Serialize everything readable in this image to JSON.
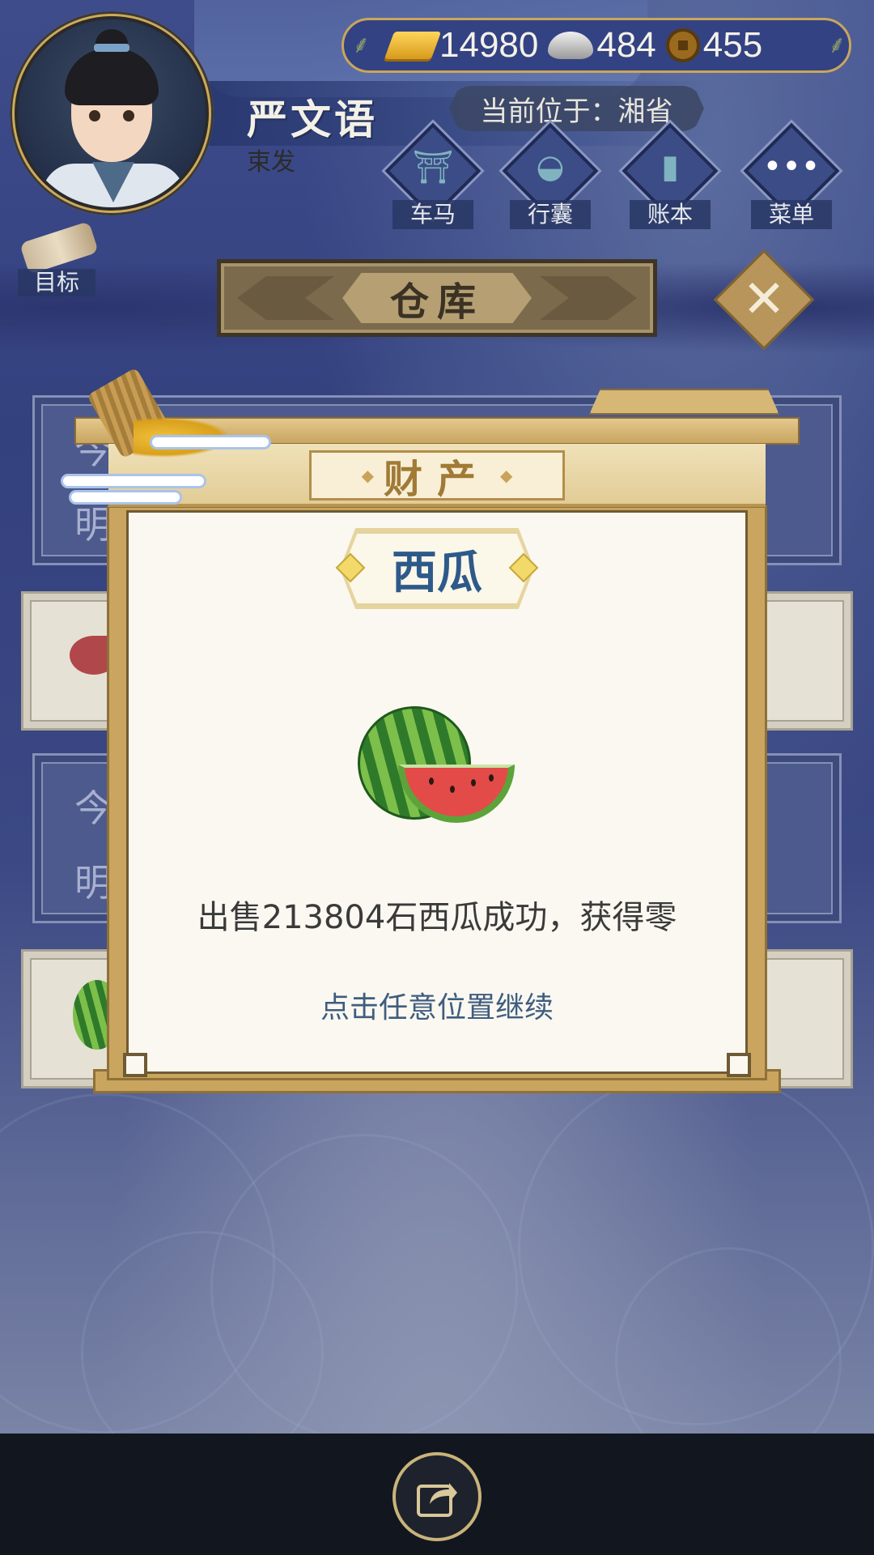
{
  "player": {
    "name": "严文语",
    "rank": "束发"
  },
  "currency": {
    "gold": "14980",
    "silver": "484",
    "copper": "455"
  },
  "location": {
    "label": "当前位于：湘省"
  },
  "nav": [
    {
      "label": "车马",
      "icon": "carriage-icon"
    },
    {
      "label": "行囊",
      "icon": "bag-icon"
    },
    {
      "label": "账本",
      "icon": "ledger-icon"
    },
    {
      "label": "菜单",
      "icon": "menu-icon"
    }
  ],
  "goal": {
    "label": "目标",
    "icon": "scroll-icon"
  },
  "warehouse": {
    "title": "仓库"
  },
  "background_rows": {
    "today_partial": "今",
    "tomorrow_partial": "明"
  },
  "modal": {
    "header": "财产",
    "item_name": "西瓜",
    "item_icon": "watermelon-icon",
    "message": "出售213804石西瓜成功，获得零",
    "hint": "点击任意位置继续"
  },
  "bottom": {
    "share_icon": "share-icon"
  },
  "colors": {
    "gold_border": "#c9a55f",
    "item_name": "#2e5a8a",
    "hint_text": "#3f5d7e",
    "bg_blue": "#3e4c8c"
  }
}
